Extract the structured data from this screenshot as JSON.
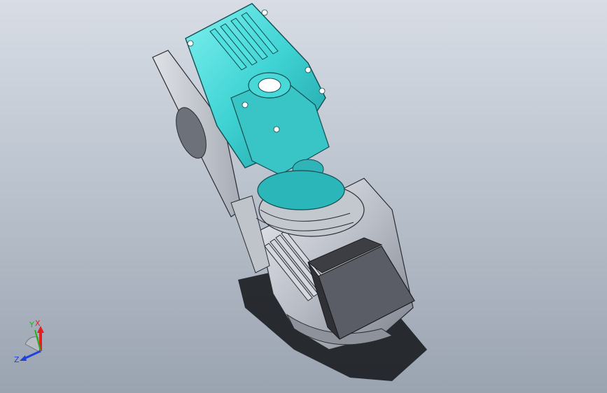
{
  "viewport": {
    "background_top": "#d8dde5",
    "background_bottom": "#9aa3b0"
  },
  "model": {
    "gearbox_color": "#3fd3d3",
    "motor_color": "#c8ccd4",
    "terminal_box_color": "#5a5d66"
  },
  "triad": {
    "axis_x": "X",
    "axis_y": "Y",
    "axis_z": "Z",
    "color_x": "#e02020",
    "color_y": "#20b020",
    "color_z": "#2040e0"
  }
}
